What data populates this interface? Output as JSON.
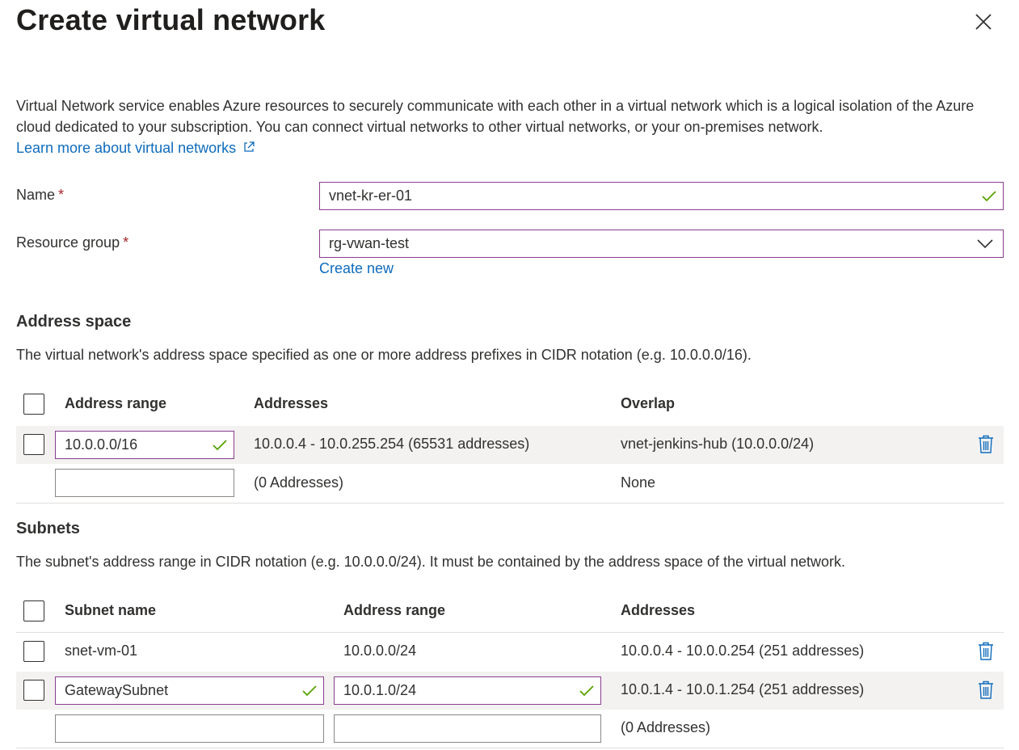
{
  "header": {
    "title": "Create virtual network",
    "close_icon": "close-icon"
  },
  "intro": {
    "text": "Virtual Network service enables Azure resources to securely communicate with each other in a virtual network which is a logical isolation of the Azure cloud dedicated to your subscription. You can connect virtual networks to other virtual networks, or your on-premises network.",
    "link": "Learn more about virtual networks"
  },
  "form": {
    "name_label": "Name",
    "name_value": "vnet-kr-er-01",
    "rg_label": "Resource group",
    "rg_value": "rg-vwan-test",
    "create_new": "Create new",
    "required_mark": "*"
  },
  "address_space": {
    "heading": "Address space",
    "description": "The virtual network's address space specified as one or more address prefixes in CIDR notation (e.g. 10.0.0.0/16).",
    "columns": [
      "Address range",
      "Addresses",
      "Overlap"
    ],
    "rows": [
      {
        "range": "10.0.0.0/16",
        "addresses": "10.0.0.4 - 10.0.255.254 (65531 addresses)",
        "overlap": "vnet-jenkins-hub (10.0.0.0/24)"
      },
      {
        "range": "",
        "addresses": "(0 Addresses)",
        "overlap": "None"
      }
    ]
  },
  "subnets": {
    "heading": "Subnets",
    "description": "The subnet's address range in CIDR notation (e.g. 10.0.0.0/24). It must be contained by the address space of the virtual network.",
    "columns": [
      "Subnet name",
      "Address range",
      "Addresses"
    ],
    "rows": [
      {
        "name": "snet-vm-01",
        "range": "10.0.0.0/24",
        "addresses": "10.0.0.4 - 10.0.0.254 (251 addresses)"
      },
      {
        "name": "GatewaySubnet",
        "range": "10.0.1.0/24",
        "addresses": "10.0.1.4 - 10.0.1.254 (251 addresses)"
      },
      {
        "name": "",
        "range": "",
        "addresses": "(0 Addresses)"
      }
    ]
  },
  "colors": {
    "link": "#0f6cbd",
    "focus_border": "#8a3d8f",
    "valid_check": "#57a300",
    "required": "#a4262c",
    "row_highlight": "#f3f2f1"
  }
}
